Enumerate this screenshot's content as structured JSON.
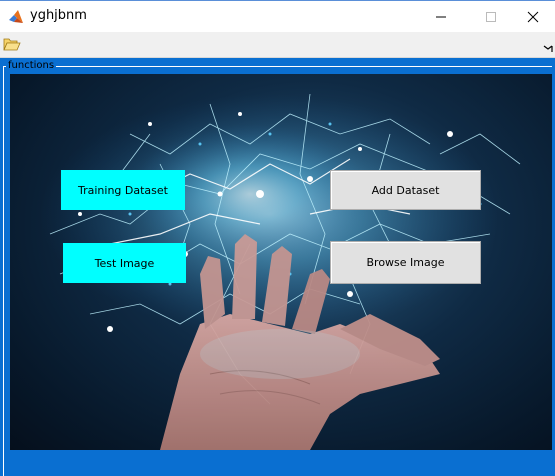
{
  "window": {
    "title": "yghjbnm"
  },
  "panel": {
    "title": "functions"
  },
  "buttons": {
    "training_dataset": "Training Dataset",
    "test_image": "Test Image",
    "add_dataset": "Add Dataset",
    "browse_image": "Browse Image"
  },
  "icons": {
    "app": "matlab-icon",
    "open": "open-folder-icon",
    "overflow": "toolbar-overflow-icon",
    "minimize": "minimize-icon",
    "maximize": "maximize-icon",
    "close": "close-icon"
  },
  "colors": {
    "figure_background": "#0a6fd1",
    "cyan_button": "#00ffff",
    "gray_button": "#e1e1e1"
  }
}
